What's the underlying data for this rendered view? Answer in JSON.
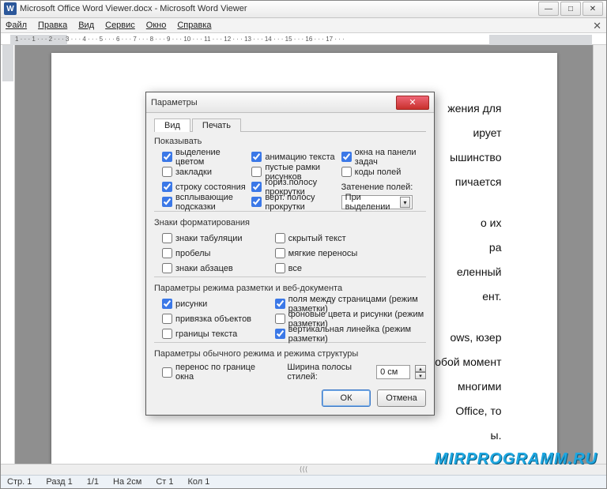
{
  "window": {
    "title": "Microsoft Office Word Viewer.docx - Microsoft Word Viewer",
    "app_icon_letter": "W",
    "min": "—",
    "max": "□",
    "close": "✕"
  },
  "menu": {
    "file": "Файл",
    "edit": "Правка",
    "view": "Вид",
    "service": "Сервис",
    "window": "Окно",
    "help": "Справка",
    "close_doc": "✕"
  },
  "ruler_ticks": "1 · · · 1 · · · 2 · · · 3 · · · 4 · · · 5 · · · 6 · · · 7 · · · 8 · · · 9 · · · 10 · · · 11 · · · 12 · · · 13 · · · 14 · · · 15 · · · 16 · · · 17 · · ·",
  "page_text": {
    "p1_tail": "жения для",
    "p2_tail": "ирует",
    "p3_tail": "ышинство",
    "p4_tail": "пичается",
    "p5_tail": "о их",
    "p6_tail": "ра",
    "p7_tail": "еленный",
    "p8_tail": "ент.",
    "p9_tail": "ows, юзер",
    "p10_tail": "обой момент",
    "p11_tail": "многими",
    "p12_tail": "Office, то",
    "p13_tail": "ы."
  },
  "statusbar": {
    "page": "Стр. 1",
    "section": "Разд 1",
    "pages": "1/1",
    "at": "На 2см",
    "line": "Ст 1",
    "col": "Кол 1"
  },
  "dialog": {
    "title": "Параметры",
    "tabs": {
      "view": "Вид",
      "print": "Печать"
    },
    "groups": {
      "show": {
        "title": "Показывать",
        "col1": [
          {
            "label": "выделение цветом",
            "checked": true
          },
          {
            "label": "закладки",
            "checked": false
          },
          {
            "label": "строку состояния",
            "checked": true
          },
          {
            "label": "всплывающие подсказки",
            "checked": true
          }
        ],
        "col2": [
          {
            "label": "анимацию текста",
            "checked": true
          },
          {
            "label": "пустые рамки рисунков",
            "checked": false
          },
          {
            "label": "гориз.полосу прокрутки",
            "checked": true
          },
          {
            "label": "верт. полосу прокрутки",
            "checked": true
          }
        ],
        "col3": [
          {
            "label": "окна на панели задач",
            "checked": true
          },
          {
            "label": "коды полей",
            "checked": false
          }
        ],
        "shade_label": "Затенение полей:",
        "shade_value": "При выделении"
      },
      "fmt": {
        "title": "Знаки форматирования",
        "col1": [
          {
            "label": "знаки табуляции",
            "checked": false
          },
          {
            "label": "пробелы",
            "checked": false
          },
          {
            "label": "знаки абзацев",
            "checked": false
          }
        ],
        "col2": [
          {
            "label": "скрытый текст",
            "checked": false
          },
          {
            "label": "мягкие переносы",
            "checked": false
          },
          {
            "label": "все",
            "checked": false
          }
        ]
      },
      "layout": {
        "title": "Параметры режима разметки и веб-документа",
        "col1": [
          {
            "label": "рисунки",
            "checked": true
          },
          {
            "label": "привязка объектов",
            "checked": false
          },
          {
            "label": "границы текста",
            "checked": false
          }
        ],
        "col2": [
          {
            "label": "поля между страницами (режим разметки)",
            "checked": true
          },
          {
            "label": "фоновые цвета и рисунки (режим разметки)",
            "checked": false
          },
          {
            "label": "вертикальная линейка (режим разметки)",
            "checked": true
          }
        ]
      },
      "normal": {
        "title": "Параметры обычного режима и режима структуры",
        "wrap": {
          "label": "перенос по границе окна",
          "checked": false
        },
        "style_width_label": "Ширина полосы стилей:",
        "style_width_value": "0 см"
      }
    },
    "buttons": {
      "ok": "ОК",
      "cancel": "Отмена"
    }
  },
  "watermark": "MIRPROGRAMM.RU"
}
